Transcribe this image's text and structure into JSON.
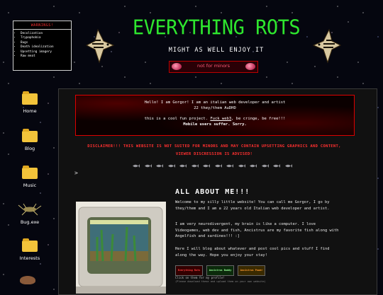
{
  "warning": {
    "title": "WARNINGS!",
    "items": [
      "Decolization",
      "Trypophobia",
      "Bugs",
      "Death idealization",
      "Upsetting imagery",
      "Raw meat"
    ]
  },
  "header": {
    "title": "EVERYTHING ROTS",
    "tagline": "MIGHT AS WELL ENJOY IT",
    "badge_label": "not for minors"
  },
  "sidebar": {
    "items": [
      {
        "label": "Home",
        "icon": "folder-icon"
      },
      {
        "label": "Blog",
        "icon": "folder-icon"
      },
      {
        "label": "Music",
        "icon": "folder-icon"
      },
      {
        "label": "Bug.exe",
        "icon": "bug-icon"
      },
      {
        "label": "Interests",
        "icon": "folder-icon"
      }
    ]
  },
  "intro": {
    "line1": "Hello! I am Gorgor! I am an italian web developer and artist",
    "line2": "22 they/them AuDHD",
    "line3_pre": "this is a cool fun project. ",
    "line3_link": "Fuck web3",
    "line3_post": ", be cringe, be free!!!",
    "line4": "Mobile users suffer. Sorry."
  },
  "disclaimer": "DISCLAIMER!!! THIS WEBSITE IS NOT SUITED FOR MINORS AND MAY CONTAIN UPSETTING GRAPHICS AND CONTENT, VIEWER DISCRESSION IS ADVISED!",
  "arrow": ">",
  "about": {
    "title": "ALL ABOUT ME!!!",
    "p1": "Welcome to my silly little website! You can call me Gorgor, I go by they/them and I am a 22 years old Italian web developer and artist.",
    "p2": "I am very neurodivergent, my brain is like a computer. I love Videogames, web dev and fish, Ancistrus are my favorite fish along with Angelfish and sardines!!! :]",
    "p3": "Here I will blog about whatever and post cool pics and stuff I find along the way. Hope you enjoy your stay!",
    "buttons": [
      "Everything Rots",
      "Ancistrus Buddy",
      "Ancistrus Power"
    ],
    "footer1": "Click on them for my profile!",
    "footer2": "(Please download these and upload them on your own website)"
  },
  "colors": {
    "title_green": "#2ee62e",
    "warning_red": "#ff3030",
    "badge_pink": "#ff5c7a"
  }
}
